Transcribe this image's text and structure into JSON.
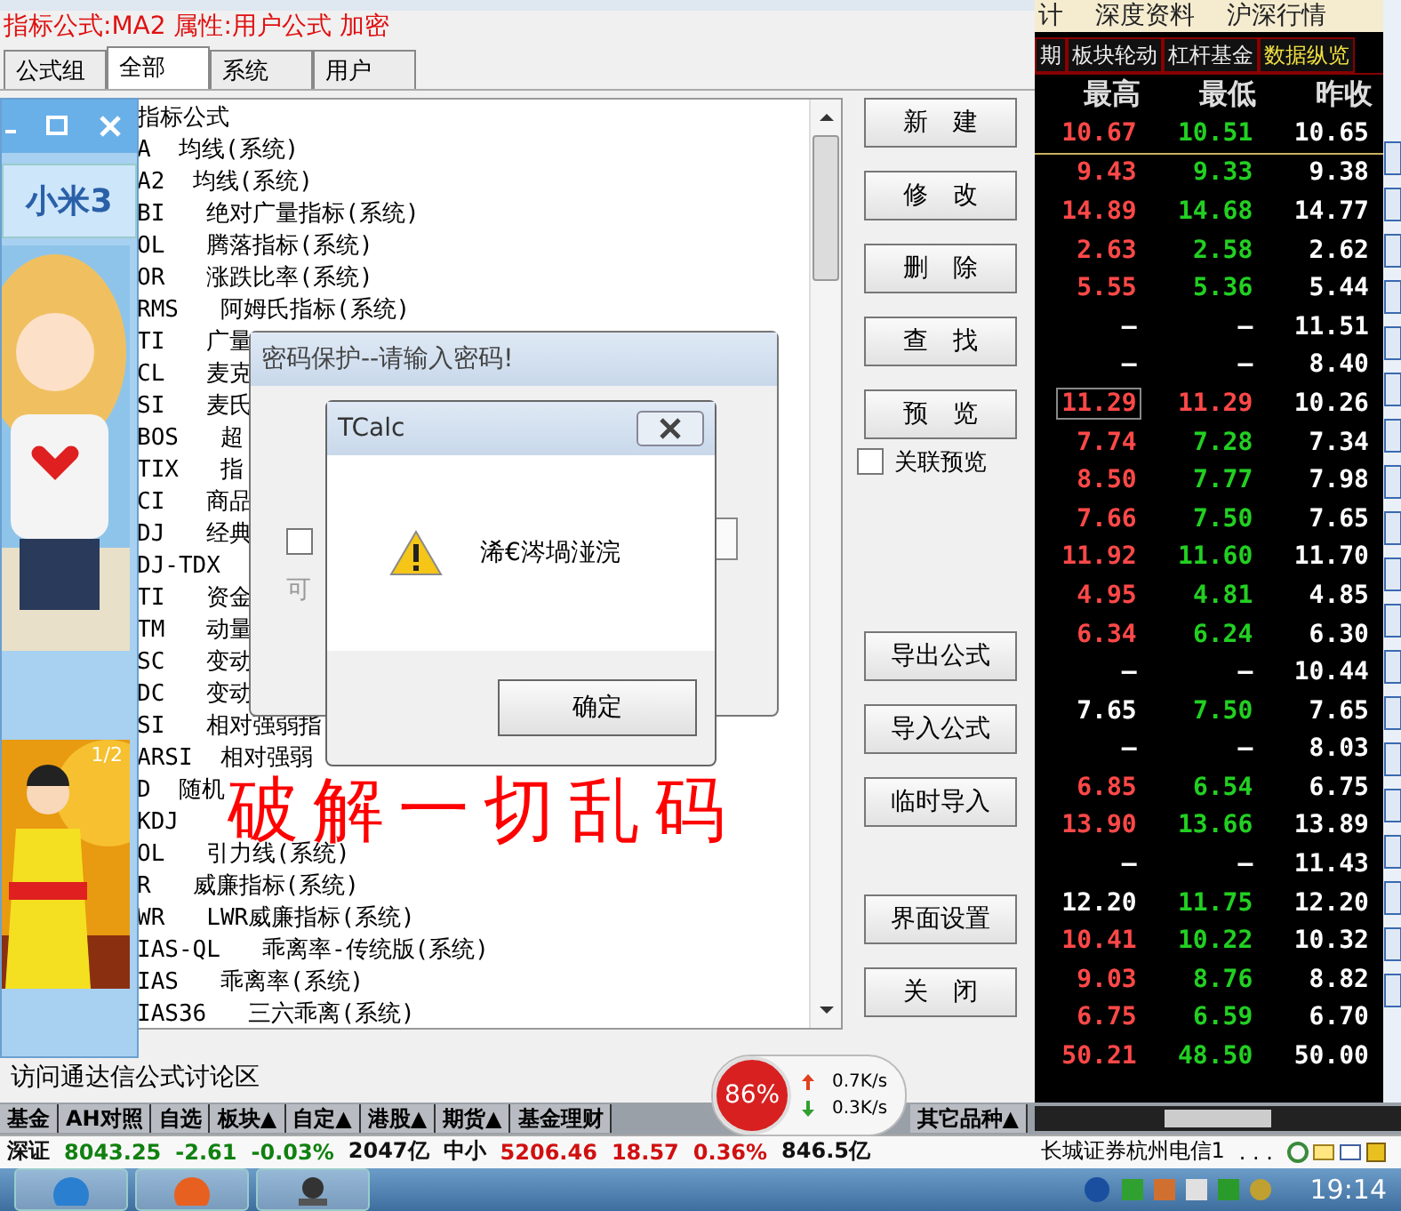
{
  "formula_title": "指标公式:MA2 属性:用户公式 加密",
  "tabs": [
    {
      "label": "公式组",
      "selected": false
    },
    {
      "label": "全部",
      "selected": true
    },
    {
      "label": "系统",
      "selected": false
    },
    {
      "label": "用户",
      "selected": false
    }
  ],
  "formula_list": {
    "heading": "指标公式",
    "items": [
      "A  均线(系统)",
      "A2  均线(系统)",
      "BI   绝对广量指标(系统)",
      "OL   腾落指标(系统)",
      "OR   涨跌比率(系统)",
      "RMS   阿姆氏指标(系统)",
      "TI   广量",
      "CL   麦克",
      "SI   麦氏",
      "BOS   超",
      "TIX   指",
      "CI   商品",
      "DJ   经典",
      "DJ-TDX",
      "TI   资金",
      "TM   动量",
      "SC   变动",
      "DC   变动",
      "SI   相对强弱指",
      "ARSI  相对强弱",
      "D  随机",
      "KDJ",
      "OL   引力线(系统)",
      "R   威廉指标(系统)",
      "WR   LWR威廉指标(系统)",
      "IAS-QL   乖离率-传统版(系统)",
      "IAS   乖离率(系统)",
      "IAS36   三六乖离(系统)"
    ]
  },
  "edit_buttons": [
    "新　建",
    "修　改",
    "删　除",
    "查　找",
    "预　览"
  ],
  "preview_checkbox": {
    "label": "关联预览",
    "checked": false
  },
  "import_buttons": [
    "导出公式",
    "导入公式",
    "临时导入"
  ],
  "window_buttons": [
    "界面设置",
    "关　闭"
  ],
  "status_text": "访问通达信公式讨论区",
  "ad_popup": {
    "banner": "小米3",
    "badge": "1/2"
  },
  "password_dialog": {
    "title": "密码保护--请输入密码!",
    "checked": false,
    "hint": "可"
  },
  "alert": {
    "title": "TCalc",
    "message": "浠€涔堝湴浣",
    "button": "确定"
  },
  "overlay_caption": "破解一切乱码",
  "quote_panel": {
    "top_tabs": [
      "计",
      "深度资料",
      "沪深行情"
    ],
    "tabs": [
      {
        "label": "期",
        "selected": false
      },
      {
        "label": "板块轮动",
        "selected": false
      },
      {
        "label": "杠杆基金",
        "selected": false
      },
      {
        "label": "数据纵览",
        "selected": true
      }
    ],
    "columns": [
      "最高",
      "最低",
      "昨收"
    ],
    "rows": [
      {
        "cells": [
          {
            "text": "10.67",
            "color": "#ff4848"
          },
          {
            "text": "10.51",
            "color": "#22d022"
          },
          {
            "text": "10.65",
            "color": "#ffffff"
          }
        ],
        "selected": false
      },
      {
        "cells": [
          {
            "text": "9.43",
            "color": "#ff4848"
          },
          {
            "text": "9.33",
            "color": "#22d022"
          },
          {
            "text": "9.38",
            "color": "#ffffff"
          }
        ],
        "selected": false
      },
      {
        "cells": [
          {
            "text": "14.89",
            "color": "#ff4848"
          },
          {
            "text": "14.68",
            "color": "#22d022"
          },
          {
            "text": "14.77",
            "color": "#ffffff"
          }
        ],
        "selected": false
      },
      {
        "cells": [
          {
            "text": "2.63",
            "color": "#ff4848"
          },
          {
            "text": "2.58",
            "color": "#22d022"
          },
          {
            "text": "2.62",
            "color": "#ffffff"
          }
        ],
        "selected": false
      },
      {
        "cells": [
          {
            "text": "5.55",
            "color": "#ff4848"
          },
          {
            "text": "5.36",
            "color": "#22d022"
          },
          {
            "text": "5.44",
            "color": "#ffffff"
          }
        ],
        "selected": false
      },
      {
        "cells": [
          {
            "text": "–",
            "color": "#ffffff"
          },
          {
            "text": "–",
            "color": "#ffffff"
          },
          {
            "text": "11.51",
            "color": "#ffffff"
          }
        ],
        "selected": false
      },
      {
        "cells": [
          {
            "text": "–",
            "color": "#ffffff"
          },
          {
            "text": "–",
            "color": "#ffffff"
          },
          {
            "text": "8.40",
            "color": "#ffffff"
          }
        ],
        "selected": false
      },
      {
        "cells": [
          {
            "text": "11.29",
            "color": "#ff4848"
          },
          {
            "text": "11.29",
            "color": "#ff4848"
          },
          {
            "text": "10.26",
            "color": "#ffffff"
          }
        ],
        "selected": true
      },
      {
        "cells": [
          {
            "text": "7.74",
            "color": "#ff4848"
          },
          {
            "text": "7.28",
            "color": "#22d022"
          },
          {
            "text": "7.34",
            "color": "#ffffff"
          }
        ],
        "selected": false
      },
      {
        "cells": [
          {
            "text": "8.50",
            "color": "#ff4848"
          },
          {
            "text": "7.77",
            "color": "#22d022"
          },
          {
            "text": "7.98",
            "color": "#ffffff"
          }
        ],
        "selected": false
      },
      {
        "cells": [
          {
            "text": "7.66",
            "color": "#ff4848"
          },
          {
            "text": "7.50",
            "color": "#22d022"
          },
          {
            "text": "7.65",
            "color": "#ffffff"
          }
        ],
        "selected": false
      },
      {
        "cells": [
          {
            "text": "11.92",
            "color": "#ff4848"
          },
          {
            "text": "11.60",
            "color": "#22d022"
          },
          {
            "text": "11.70",
            "color": "#ffffff"
          }
        ],
        "selected": false
      },
      {
        "cells": [
          {
            "text": "4.95",
            "color": "#ff4848"
          },
          {
            "text": "4.81",
            "color": "#22d022"
          },
          {
            "text": "4.85",
            "color": "#ffffff"
          }
        ],
        "selected": false
      },
      {
        "cells": [
          {
            "text": "6.34",
            "color": "#ff4848"
          },
          {
            "text": "6.24",
            "color": "#22d022"
          },
          {
            "text": "6.30",
            "color": "#ffffff"
          }
        ],
        "selected": false
      },
      {
        "cells": [
          {
            "text": "–",
            "color": "#ffffff"
          },
          {
            "text": "–",
            "color": "#ffffff"
          },
          {
            "text": "10.44",
            "color": "#ffffff"
          }
        ],
        "selected": false
      },
      {
        "cells": [
          {
            "text": "7.65",
            "color": "#ffffff"
          },
          {
            "text": "7.50",
            "color": "#22d022"
          },
          {
            "text": "7.65",
            "color": "#ffffff"
          }
        ],
        "selected": false
      },
      {
        "cells": [
          {
            "text": "–",
            "color": "#ffffff"
          },
          {
            "text": "–",
            "color": "#ffffff"
          },
          {
            "text": "8.03",
            "color": "#ffffff"
          }
        ],
        "selected": false
      },
      {
        "cells": [
          {
            "text": "6.85",
            "color": "#ff4848"
          },
          {
            "text": "6.54",
            "color": "#22d022"
          },
          {
            "text": "6.75",
            "color": "#ffffff"
          }
        ],
        "selected": false
      },
      {
        "cells": [
          {
            "text": "13.90",
            "color": "#ff4848"
          },
          {
            "text": "13.66",
            "color": "#22d022"
          },
          {
            "text": "13.89",
            "color": "#ffffff"
          }
        ],
        "selected": false
      },
      {
        "cells": [
          {
            "text": "–",
            "color": "#ffffff"
          },
          {
            "text": "–",
            "color": "#ffffff"
          },
          {
            "text": "11.43",
            "color": "#ffffff"
          }
        ],
        "selected": false
      },
      {
        "cells": [
          {
            "text": "12.20",
            "color": "#ffffff"
          },
          {
            "text": "11.75",
            "color": "#22d022"
          },
          {
            "text": "12.20",
            "color": "#ffffff"
          }
        ],
        "selected": false
      },
      {
        "cells": [
          {
            "text": "10.41",
            "color": "#ff4848"
          },
          {
            "text": "10.22",
            "color": "#22d022"
          },
          {
            "text": "10.32",
            "color": "#ffffff"
          }
        ],
        "selected": false
      },
      {
        "cells": [
          {
            "text": "9.03",
            "color": "#ff4848"
          },
          {
            "text": "8.76",
            "color": "#22d022"
          },
          {
            "text": "8.82",
            "color": "#ffffff"
          }
        ],
        "selected": false
      },
      {
        "cells": [
          {
            "text": "6.75",
            "color": "#ff4848"
          },
          {
            "text": "6.59",
            "color": "#22d022"
          },
          {
            "text": "6.70",
            "color": "#ffffff"
          }
        ],
        "selected": false
      },
      {
        "cells": [
          {
            "text": "50.21",
            "color": "#ff4848"
          },
          {
            "text": "48.50",
            "color": "#22d022"
          },
          {
            "text": "50.00",
            "color": "#ffffff"
          }
        ],
        "selected": false
      }
    ]
  },
  "market_tabs": [
    "基金",
    "AH对照",
    "自选",
    "板块▲",
    "自定▲",
    "港股▲",
    "期货▲",
    "基金理财",
    "其它品种▲"
  ],
  "ticker": [
    {
      "text": "深证",
      "color": "#111111"
    },
    {
      "text": "8043.25",
      "color": "#108010"
    },
    {
      "text": "-2.61",
      "color": "#108010"
    },
    {
      "text": "-0.03%",
      "color": "#108010"
    },
    {
      "text": "2047亿",
      "color": "#111111"
    },
    {
      "text": "中小",
      "color": "#111111"
    },
    {
      "text": "5206.46",
      "color": "#d01010"
    },
    {
      "text": "18.57",
      "color": "#d01010"
    },
    {
      "text": "0.36%",
      "color": "#d01010"
    },
    {
      "text": "846.5亿",
      "color": "#111111"
    }
  ],
  "broker": "长城证券杭州电信1",
  "broker_more": ". . .",
  "net_widget": {
    "usage": "86%",
    "up": "0.7K/s",
    "down": "0.3K/s"
  },
  "clock": "19:14"
}
